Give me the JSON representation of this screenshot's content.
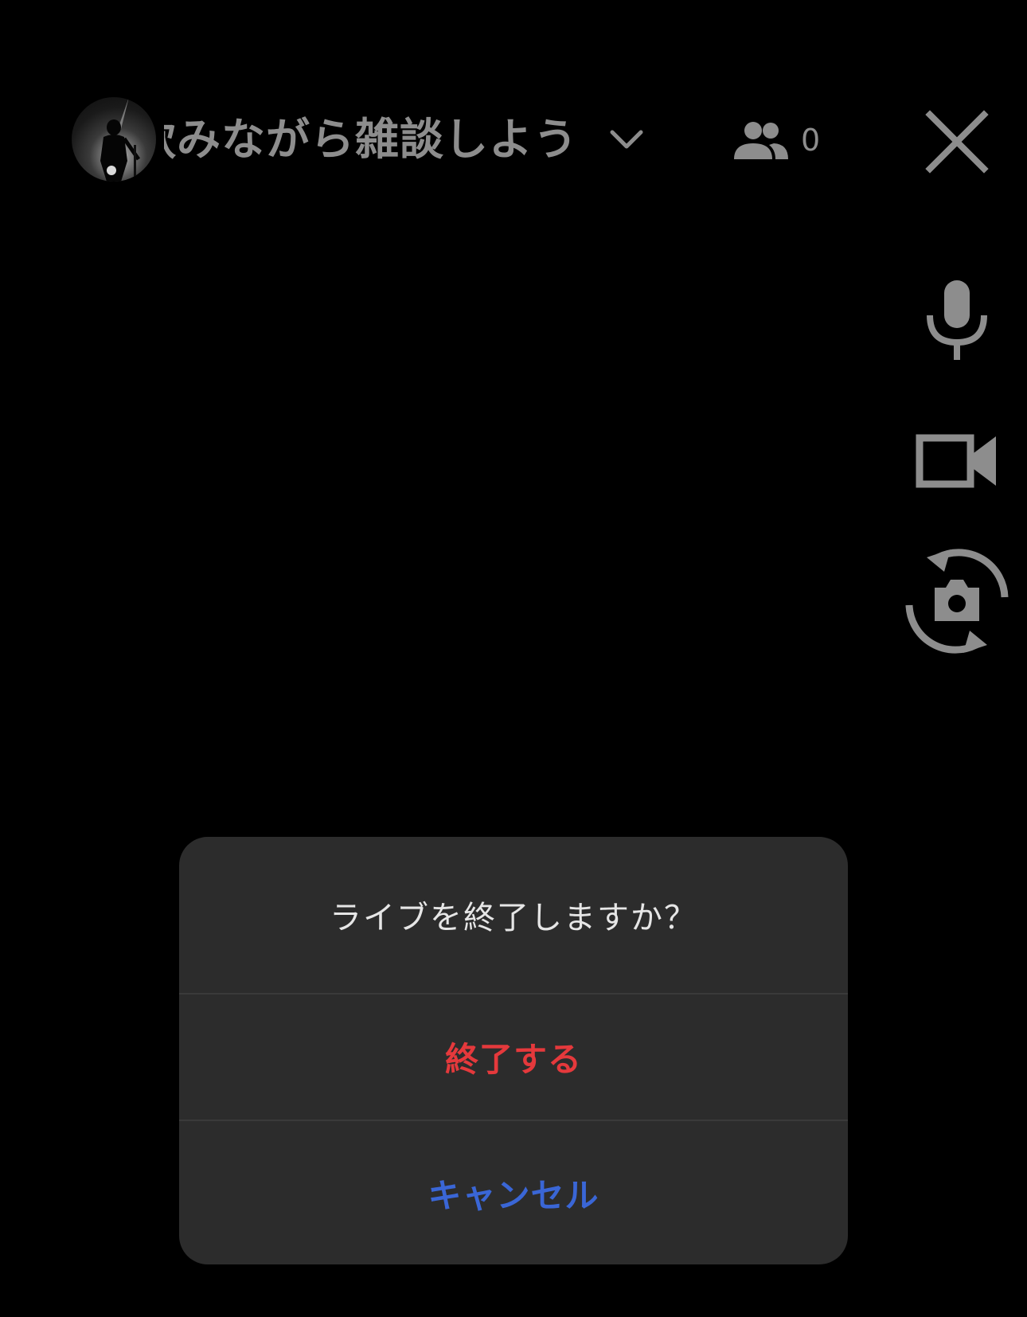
{
  "header": {
    "stream_title": "飲みながら雑談しよう",
    "viewer_count": "0",
    "icons": {
      "avatar": "user-avatar",
      "chevron": "chevron-down-icon",
      "viewers": "people-icon",
      "close": "close-icon"
    }
  },
  "side_controls": {
    "icons": [
      "microphone-icon",
      "video-camera-icon",
      "switch-camera-icon"
    ]
  },
  "dialog": {
    "title": "ライブを終了しますか？",
    "confirm_label": "終了する",
    "cancel_label": "キャンセル"
  },
  "colors": {
    "background": "#000000",
    "dialog_bg": "#2c2c2c",
    "icon_gray": "#8d8d8d",
    "destructive": "#e5393c",
    "link_blue": "#3a66d6",
    "dialog_text": "#e6e6e6"
  }
}
